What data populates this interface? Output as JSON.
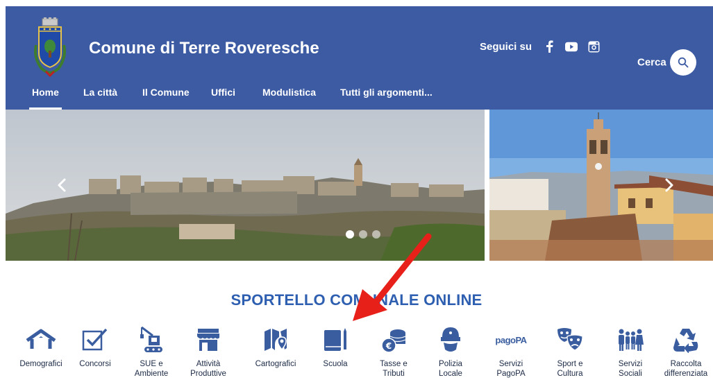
{
  "header": {
    "title": "Comune di Terre Roveresche",
    "social_label": "Seguici su",
    "social_icons": [
      "facebook-icon",
      "youtube-icon",
      "instagram-icon"
    ],
    "search_label": "Cerca"
  },
  "nav": {
    "items": [
      {
        "label": "Home",
        "active": true
      },
      {
        "label": "La città"
      },
      {
        "label": "Il Comune"
      },
      {
        "label": "Uffici"
      },
      {
        "label": "Modulistica"
      },
      {
        "label": "Tutti gli argomenti..."
      }
    ]
  },
  "carousel": {
    "slides": 3,
    "active_slide": 1
  },
  "services": {
    "title": "SPORTELLO COMUNALE ONLINE",
    "items": [
      {
        "label": "Demografici",
        "icon": "house-icon"
      },
      {
        "label": "Concorsi",
        "icon": "checkbox-icon"
      },
      {
        "label": "SUE e\nAmbiente",
        "icon": "crane-icon"
      },
      {
        "label": "Attività\nProduttive",
        "icon": "shop-icon"
      },
      {
        "label": "Cartografici",
        "icon": "map-icon"
      },
      {
        "label": "Scuola",
        "icon": "book-icon"
      },
      {
        "label": "Tasse e\nTributi",
        "icon": "coins-icon"
      },
      {
        "label": "Polizia\nLocale",
        "icon": "police-icon"
      },
      {
        "label": "Servizi\nPagoPA",
        "icon": "pagopa-icon",
        "icon_text": "pagoPA"
      },
      {
        "label": "Sport e\nCultura",
        "icon": "theater-masks-icon"
      },
      {
        "label": "Servizi\nSociali",
        "icon": "people-icon"
      },
      {
        "label": "Raccolta\ndifferenziata",
        "icon": "recycle-icon"
      }
    ]
  },
  "colors": {
    "header_bg": "#3c5ba3",
    "accent": "#2f5fb0",
    "icon": "#3a5d9f",
    "annotation_arrow": "#e8201a"
  }
}
